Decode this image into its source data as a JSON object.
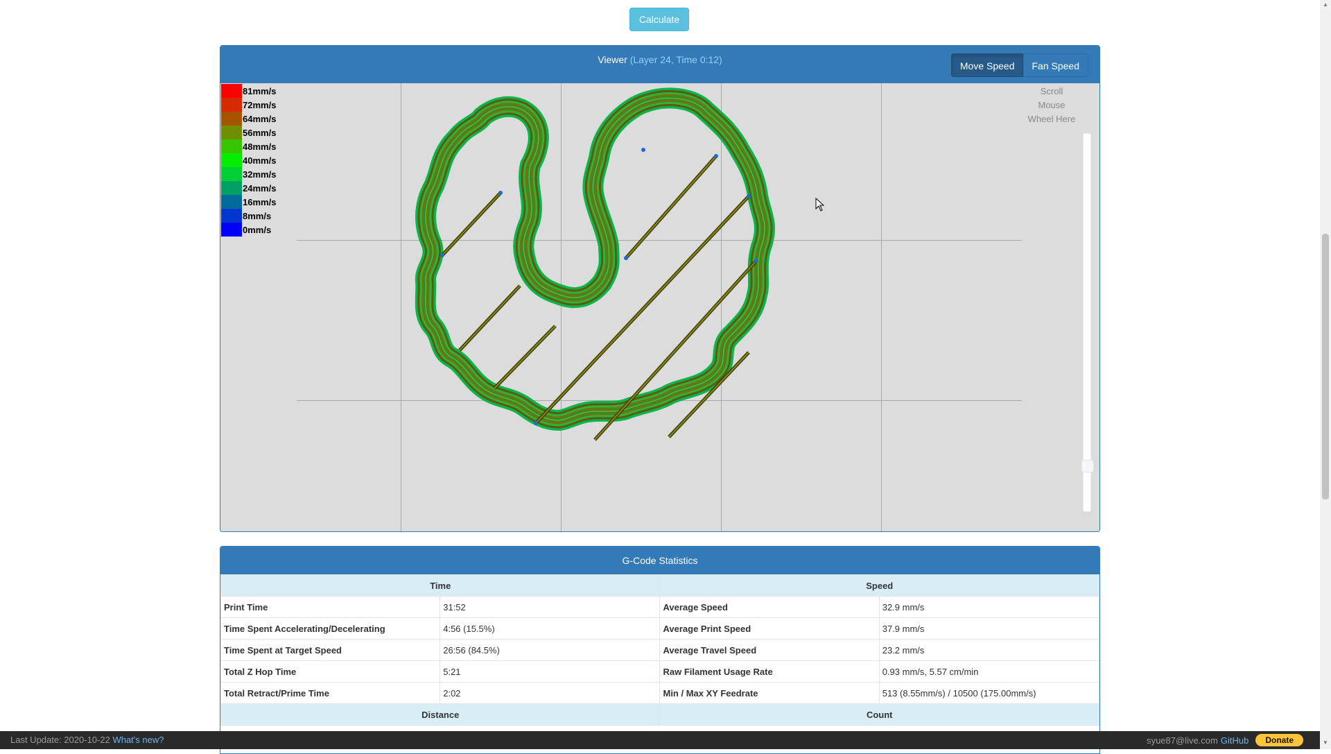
{
  "calculate_label": "Calculate",
  "viewer": {
    "title": "Viewer",
    "subtitle": "(Layer 24, Time 0:12)",
    "buttons": [
      {
        "label": "Move Speed",
        "active": true
      },
      {
        "label": "Fan Speed",
        "active": false
      }
    ],
    "legend": [
      {
        "label": "81mm/s",
        "color": "#ff0000"
      },
      {
        "label": "72mm/s",
        "color": "#d62a00"
      },
      {
        "label": "64mm/s",
        "color": "#a65400"
      },
      {
        "label": "56mm/s",
        "color": "#6f8f00"
      },
      {
        "label": "48mm/s",
        "color": "#36c600"
      },
      {
        "label": "40mm/s",
        "color": "#00ee00"
      },
      {
        "label": "32mm/s",
        "color": "#00cf36"
      },
      {
        "label": "24mm/s",
        "color": "#00a064"
      },
      {
        "label": "16mm/s",
        "color": "#006a9a"
      },
      {
        "label": "8mm/s",
        "color": "#0036d0"
      },
      {
        "label": "0mm/s",
        "color": "#0000ff"
      }
    ],
    "scroll_hint": [
      "Scroll",
      "Mouse",
      "Wheel Here"
    ],
    "toolpath_colors": {
      "outer": "#0cb54c",
      "inner": "#6b6b10",
      "infill": "#77770a",
      "travel_point": "#1e6ad0"
    },
    "grid_color": "#a8a8a8",
    "canvas_bg": "#dcdcdc"
  },
  "stats": {
    "title": "G-Code Statistics",
    "time_header": "Time",
    "speed_header": "Speed",
    "rows": [
      {
        "k1": "Print Time",
        "v1": "31:52",
        "k2": "Average Speed",
        "v2": "32.9 mm/s"
      },
      {
        "k1": "Time Spent Accelerating/Decelerating",
        "v1": "4:56 (15.5%)",
        "k2": "Average Print Speed",
        "v2": "37.9 mm/s"
      },
      {
        "k1": "Time Spent at Target Speed",
        "v1": "26:56 (84.5%)",
        "k2": "Average Travel Speed",
        "v2": "23.2 mm/s"
      },
      {
        "k1": "Total Z Hop Time",
        "v1": "5:21",
        "k2": "Raw Filament Usage Rate",
        "v2": "0.93 mm/s, 5.57 cm/min"
      },
      {
        "k1": "Total Retract/Prime Time",
        "v1": "2:02",
        "k2": "Min / Max XY Feedrate",
        "v2": "513 (8.55mm/s) / 10500 (175.00mm/s)"
      }
    ],
    "distance_header": "Distance",
    "count_header": "Count"
  },
  "footer": {
    "last_update": "Last Update: 2020-10-22",
    "whats_new": "What's new?",
    "email": "syue87@live.com",
    "github": "GitHub",
    "donate": "Donate"
  }
}
